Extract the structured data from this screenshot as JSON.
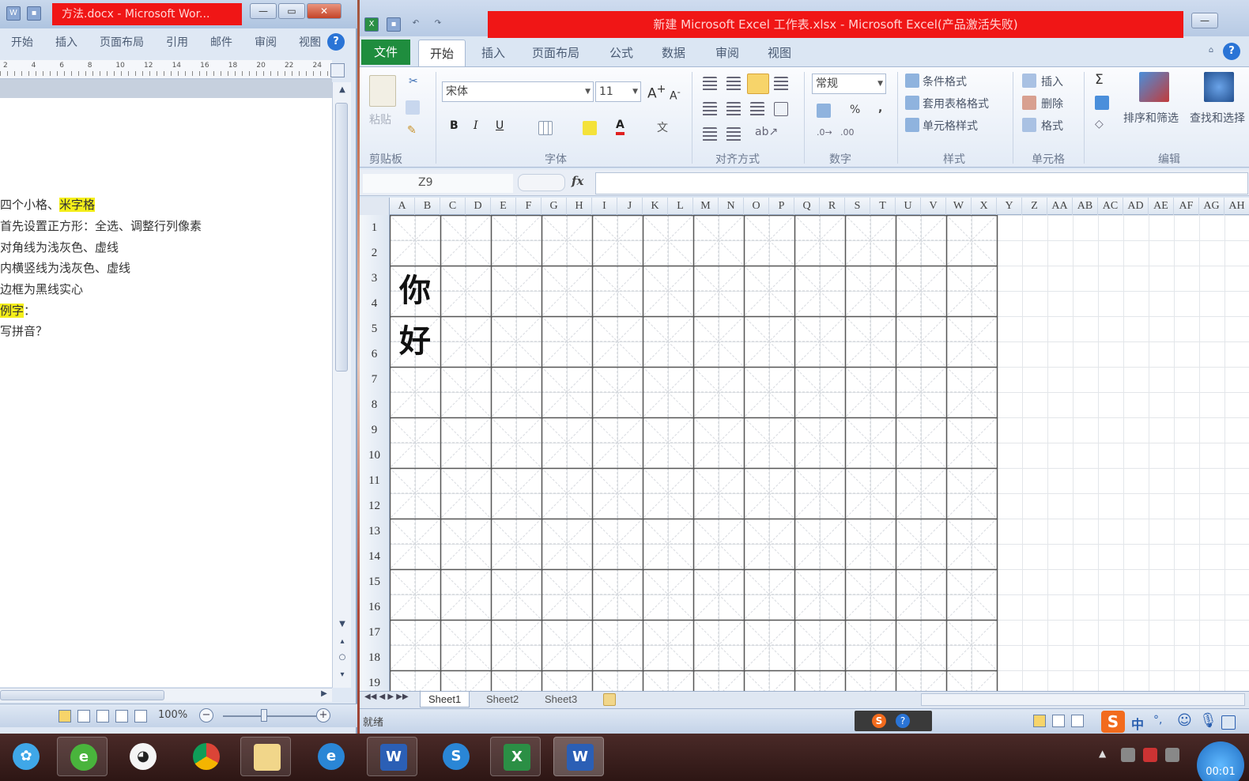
{
  "word": {
    "title": "方法.docx - Microsoft Wor...",
    "tabs": [
      "开始",
      "插入",
      "页面布局",
      "引用",
      "邮件",
      "审阅",
      "视图"
    ],
    "ruler_labels": [
      "2",
      "4",
      "6",
      "8",
      "10",
      "12",
      "14",
      "16",
      "18",
      "20",
      "22",
      "24"
    ],
    "lines": [
      {
        "before": "四个小格、",
        "highlight": "米字格",
        "after": ""
      },
      {
        "before": "首先设置正方形：全选、调整行列像素",
        "highlight": "",
        "after": ""
      },
      {
        "before": "对角线为浅灰色、虚线",
        "highlight": "",
        "after": ""
      },
      {
        "before": "内横竖线为浅灰色、虚线",
        "highlight": "",
        "after": ""
      },
      {
        "before": "边框为黑线实心",
        "highlight": "",
        "after": ""
      },
      {
        "before": "",
        "highlight": "例字",
        "after": "："
      },
      {
        "before": "写拼音？",
        "highlight": "",
        "after": ""
      }
    ],
    "zoom": "100%"
  },
  "excel": {
    "title": "新建 Microsoft Excel 工作表.xlsx - Microsoft Excel(产品激活失败)",
    "file_tab": "文件",
    "tabs": [
      "开始",
      "插入",
      "页面布局",
      "公式",
      "数据",
      "审阅",
      "视图"
    ],
    "active_tab": "开始",
    "ribbon": {
      "paste": "粘贴",
      "font_name": "宋体",
      "font_size": "11",
      "bold": "B",
      "italic": "I",
      "underline": "U",
      "font_color": "A",
      "number_format": "常规",
      "percent": "%",
      "comma": ",",
      "conditional_format": "条件格式",
      "table_format": "套用表格格式",
      "cell_style": "单元格样式",
      "insert": "插入",
      "delete": "删除",
      "format": "格式",
      "sigma": "Σ",
      "sort_filter": "排序和筛选",
      "find_select": "查找和选择",
      "groups": [
        "剪贴板",
        "字体",
        "对齐方式",
        "数字",
        "样式",
        "单元格",
        "编辑"
      ]
    },
    "name_box": "Z9",
    "fx": "fx",
    "columns": [
      "A",
      "B",
      "C",
      "D",
      "E",
      "F",
      "G",
      "H",
      "I",
      "J",
      "K",
      "L",
      "M",
      "N",
      "O",
      "P",
      "Q",
      "R",
      "S",
      "T",
      "U",
      "V",
      "W",
      "X",
      "Y",
      "Z",
      "AA",
      "AB",
      "AC",
      "AD",
      "AE",
      "AF",
      "AG",
      "AH"
    ],
    "rows": [
      "1",
      "2",
      "3",
      "4",
      "5",
      "6",
      "7",
      "8",
      "9",
      "10",
      "11",
      "12",
      "13",
      "14",
      "15",
      "16",
      "17",
      "18",
      "19"
    ],
    "characters": [
      "你",
      "好"
    ],
    "sheets": [
      "Sheet1",
      "Sheet2",
      "Sheet3"
    ],
    "status": "就绪"
  },
  "taskbar": {
    "clock": "00:01",
    "ime": "中"
  }
}
